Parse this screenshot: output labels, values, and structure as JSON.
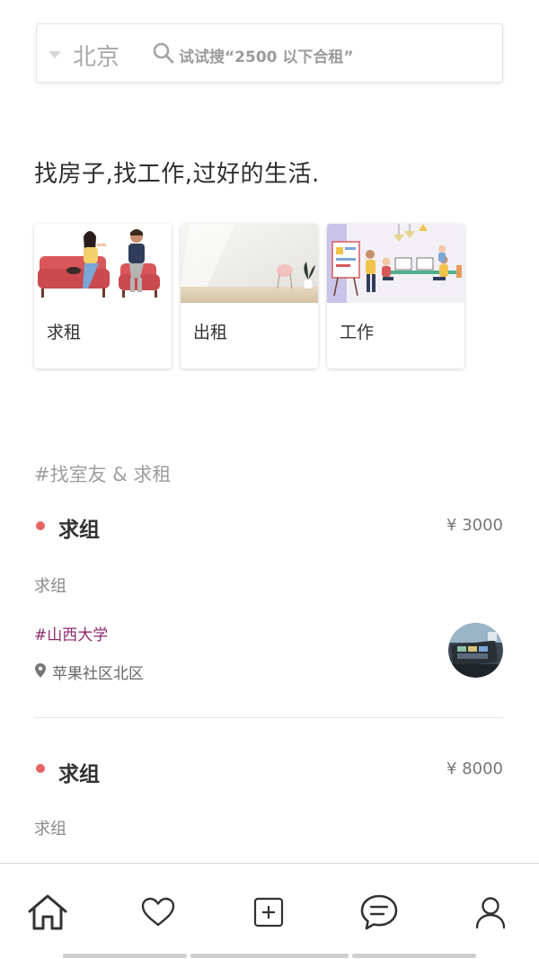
{
  "search": {
    "city": "北京",
    "placeholder": "试试搜“2500 以下合租”"
  },
  "headline": "找房子,找工作,过好的生活.",
  "categories": [
    {
      "label": "求租",
      "icon": "people-on-sofa-illustration"
    },
    {
      "label": "出租",
      "icon": "empty-room-illustration"
    },
    {
      "label": "工作",
      "icon": "office-team-illustration"
    }
  ],
  "section": {
    "title": "#找室友 & 求租"
  },
  "listings": [
    {
      "title": "求组",
      "price": "¥  3000",
      "description": "求组",
      "tag": "#山西大学",
      "location": "苹果社区北区",
      "status_color": "#e86464"
    },
    {
      "title": "求组",
      "price": "¥  8000",
      "description": "求组",
      "status_color": "#e86464"
    }
  ],
  "tabs": [
    {
      "name": "home",
      "icon": "home-icon"
    },
    {
      "name": "favorites",
      "icon": "heart-icon"
    },
    {
      "name": "publish",
      "icon": "plus-square-icon"
    },
    {
      "name": "messages",
      "icon": "chat-bubble-icon"
    },
    {
      "name": "profile",
      "icon": "user-icon"
    }
  ],
  "colors": {
    "accent_dot": "#e86464",
    "tag_text": "#8e2a6e"
  }
}
